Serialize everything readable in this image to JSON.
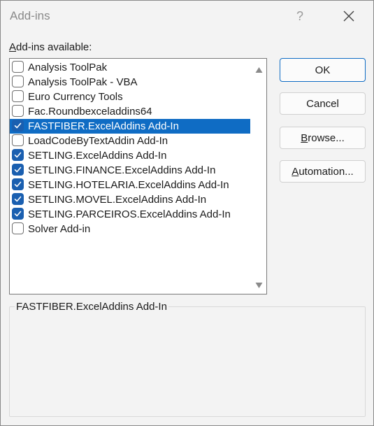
{
  "dialog": {
    "title": "Add-ins",
    "help_label": "?",
    "close_label": "Close"
  },
  "list": {
    "label_mnemonic": "A",
    "label_rest": "dd-ins available:",
    "items": [
      {
        "label": "Analysis ToolPak",
        "checked": false,
        "selected": false
      },
      {
        "label": "Analysis ToolPak - VBA",
        "checked": false,
        "selected": false
      },
      {
        "label": "Euro Currency Tools",
        "checked": false,
        "selected": false
      },
      {
        "label": "Fac.Roundbexceladdins64",
        "checked": false,
        "selected": false
      },
      {
        "label": "FASTFIBER.ExcelAddins Add-In",
        "checked": true,
        "selected": true
      },
      {
        "label": "LoadCodeByTextAddin Add-In",
        "checked": false,
        "selected": false
      },
      {
        "label": "SETLING.ExcelAddins Add-In",
        "checked": true,
        "selected": false
      },
      {
        "label": "SETLING.FINANCE.ExcelAddins Add-In",
        "checked": true,
        "selected": false
      },
      {
        "label": "SETLING.HOTELARIA.ExcelAddins Add-In",
        "checked": true,
        "selected": false
      },
      {
        "label": "SETLING.MOVEL.ExcelAddins Add-In",
        "checked": true,
        "selected": false
      },
      {
        "label": "SETLING.PARCEIROS.ExcelAddins Add-In",
        "checked": true,
        "selected": false
      },
      {
        "label": "Solver Add-in",
        "checked": false,
        "selected": false
      }
    ]
  },
  "buttons": {
    "ok": "OK",
    "cancel": "Cancel",
    "browse_mnemonic": "B",
    "browse_rest": "rowse...",
    "automation_mnemonic": "A",
    "automation_rest": "utomation..."
  },
  "description": {
    "text": "FASTFIBER.ExcelAddins Add-In"
  },
  "colors": {
    "selection": "#0f6cc4",
    "checkbox_checked": "#1a5fb0"
  }
}
